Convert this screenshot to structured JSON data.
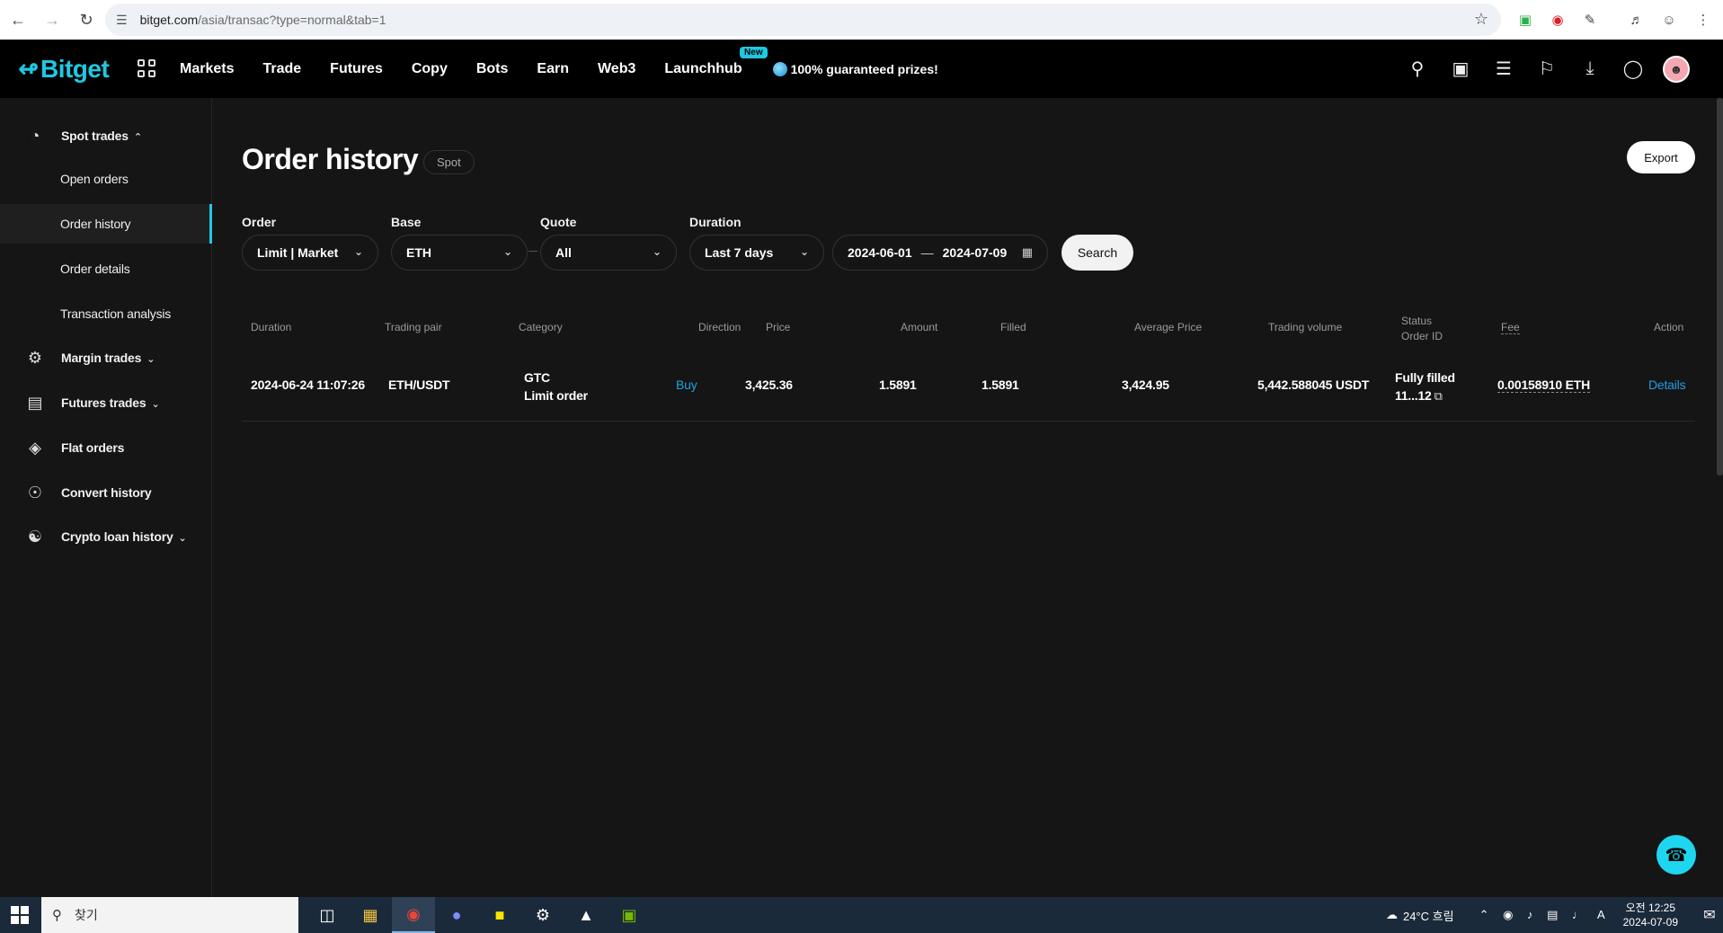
{
  "browser": {
    "url_host": "bitget.com",
    "url_path": "/asia/transac?type=normal&tab=1",
    "icons": [
      "back-icon",
      "forward-icon",
      "reload-icon",
      "site-settings-icon",
      "bookmark-star-icon",
      "extension-icons",
      "menu-icon"
    ]
  },
  "topnav": {
    "logo": "Bitget",
    "items": [
      "Markets",
      "Trade",
      "Futures",
      "Copy",
      "Bots",
      "Earn",
      "Web3",
      "Launchhub"
    ],
    "new_badge": "New",
    "promo": "100% guaranteed prizes!",
    "icons": [
      "search-icon",
      "wallet-icon",
      "orders-icon",
      "bell-icon",
      "download-icon",
      "globe-icon",
      "avatar"
    ]
  },
  "sidebar": {
    "items": [
      {
        "label": "Spot trades",
        "icon": "spot-icon",
        "expanded": true
      },
      {
        "label": "Open orders"
      },
      {
        "label": "Order history",
        "active": true
      },
      {
        "label": "Order details"
      },
      {
        "label": "Transaction analysis"
      },
      {
        "label": "Margin trades",
        "icon": "margin-icon",
        "expandable": true
      },
      {
        "label": "Futures trades",
        "icon": "futures-icon",
        "expandable": true
      },
      {
        "label": "Flat orders",
        "icon": "flat-orders-icon"
      },
      {
        "label": "Convert history",
        "icon": "convert-icon"
      },
      {
        "label": "Crypto loan history",
        "icon": "loan-icon",
        "expandable": true
      }
    ]
  },
  "page": {
    "title": "Order history",
    "tag": "Spot",
    "export": "Export"
  },
  "filters": {
    "order_label": "Order",
    "order_value": "Limit | Market",
    "base_label": "Base",
    "base_value": "ETH",
    "quote_label": "Quote",
    "quote_value": "All",
    "duration_label": "Duration",
    "duration_value": "Last 7 days",
    "date_from": "2024-06-01",
    "date_to": "2024-07-09",
    "search": "Search"
  },
  "table": {
    "headers": {
      "duration": "Duration",
      "pair": "Trading pair",
      "category": "Category",
      "direction": "Direction",
      "price": "Price",
      "amount": "Amount",
      "filled": "Filled",
      "avg_price": "Average Price",
      "volume": "Trading volume",
      "status": "Status",
      "order_id": "Order ID",
      "fee": "Fee",
      "action": "Action"
    },
    "rows": [
      {
        "time": "2024-06-24 11:07:26",
        "pair": "ETH/USDT",
        "category_1": "GTC",
        "category_2": "Limit order",
        "direction": "Buy",
        "price": "3,425.36",
        "amount": "1.5891",
        "filled": "1.5891",
        "avg_price": "3,424.95",
        "volume": "5,442.588045 USDT",
        "status": "Fully filled",
        "order_id": "11...12",
        "fee": "0.00158910 ETH",
        "action": "Details"
      }
    ]
  },
  "taskbar": {
    "search_placeholder": "찾기",
    "weather": "24°C 흐림",
    "time": "오전 12:25",
    "date": "2024-07-09",
    "ime": "A"
  },
  "colors": {
    "accent": "#1fc8e3",
    "link": "#1fa0e3",
    "background": "#151515"
  }
}
